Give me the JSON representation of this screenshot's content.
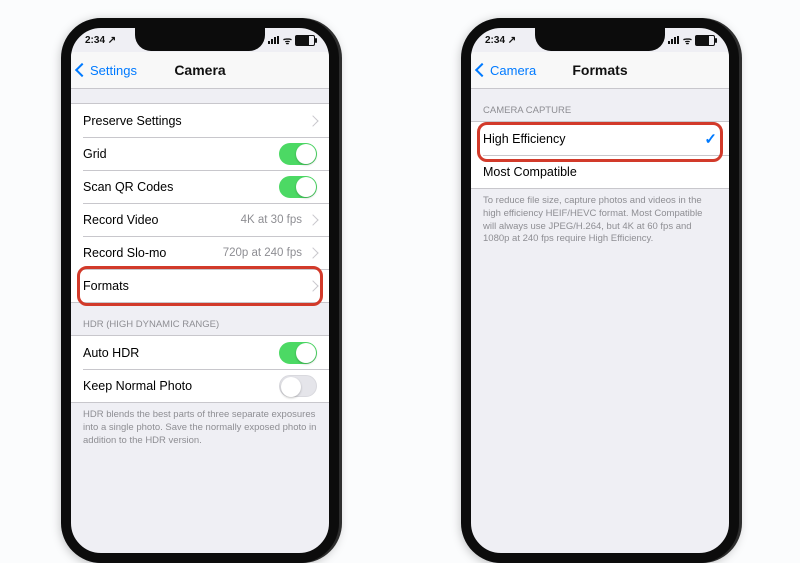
{
  "status": {
    "time": "2:34",
    "locIcon": "↗"
  },
  "phone1": {
    "back": "Settings",
    "title": "Camera",
    "rows": {
      "preserve": "Preserve Settings",
      "grid": "Grid",
      "qr": "Scan QR Codes",
      "recordVideo": "Record Video",
      "recordVideoDetail": "4K at 30 fps",
      "slomo": "Record Slo-mo",
      "slomoDetail": "720p at 240 fps",
      "formats": "Formats"
    },
    "hdrHeader": "HDR (HIGH DYNAMIC RANGE)",
    "hdr": {
      "auto": "Auto HDR",
      "keep": "Keep Normal Photo"
    },
    "hdrFooter": "HDR blends the best parts of three separate exposures into a single photo. Save the normally exposed photo in addition to the HDR version."
  },
  "phone2": {
    "back": "Camera",
    "title": "Formats",
    "captureHeader": "CAMERA CAPTURE",
    "rows": {
      "high": "High Efficiency",
      "compat": "Most Compatible"
    },
    "captureFooter": "To reduce file size, capture photos and videos in the high efficiency HEIF/HEVC format. Most Compatible will always use JPEG/H.264, but 4K at 60 fps and 1080p at 240 fps require High Efficiency."
  }
}
